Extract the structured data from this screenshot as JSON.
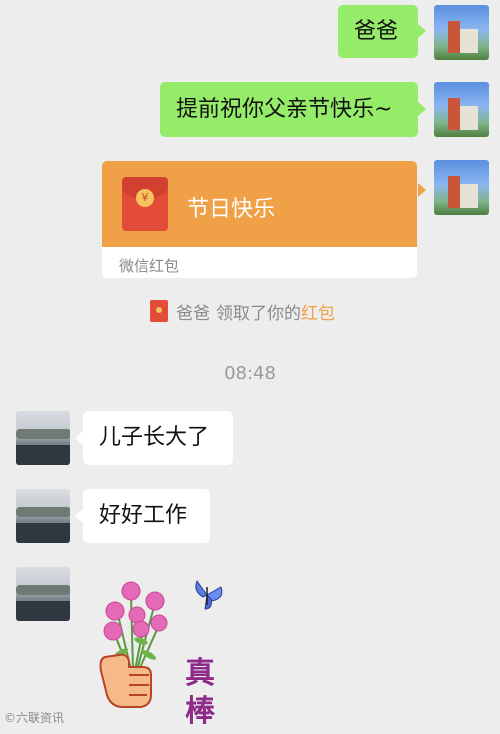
{
  "messages": [
    {
      "from": "me",
      "text": "爸爸"
    },
    {
      "from": "me",
      "text": "提前祝你父亲节快乐~"
    },
    {
      "from": "them",
      "text": "儿子长大了"
    },
    {
      "from": "them",
      "text": "好好工作"
    }
  ],
  "red_packet": {
    "title": "节日快乐",
    "footer": "微信红包",
    "coin_symbol": "¥"
  },
  "system_notice": {
    "name": "爸爸",
    "action": "领取了你的",
    "link": "红包"
  },
  "timestamp": "08:48",
  "sticker": {
    "text_line1": "真",
    "text_line2": "棒"
  },
  "watermark": "©六联资讯",
  "colors": {
    "chat_background": "#ededed",
    "my_bubble": "#95ec69",
    "their_bubble": "#ffffff",
    "red_packet_orange": "#f0a148",
    "red_packet_icon": "#e44c3a",
    "link_orange": "#f0a148"
  }
}
